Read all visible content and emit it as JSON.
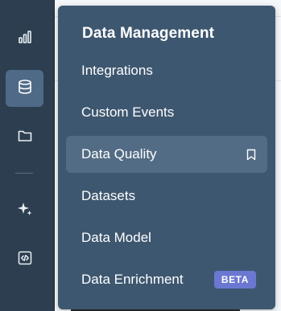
{
  "rail": {
    "items": [
      {
        "icon": "bar-chart-icon",
        "active": false
      },
      {
        "icon": "database-icon",
        "active": true
      },
      {
        "icon": "folder-icon",
        "active": false
      },
      {
        "icon": "sparkle-icon",
        "active": false
      },
      {
        "icon": "code-icon",
        "active": false
      }
    ]
  },
  "flyout": {
    "title": "Data Management",
    "items": [
      {
        "label": "Integrations"
      },
      {
        "label": "Custom Events"
      },
      {
        "label": "Data Quality",
        "selected": true,
        "icon": "bookmark-icon"
      },
      {
        "label": "Datasets"
      },
      {
        "label": "Data Model"
      },
      {
        "label": "Data Enrichment",
        "badge": "BETA"
      }
    ]
  },
  "colors": {
    "rail_bg": "#2d3e50",
    "flyout_bg": "#3e5770",
    "selected_bg": "#536c85",
    "active_rail_bg": "#4f6a86",
    "badge_bg": "#6a78d1"
  }
}
